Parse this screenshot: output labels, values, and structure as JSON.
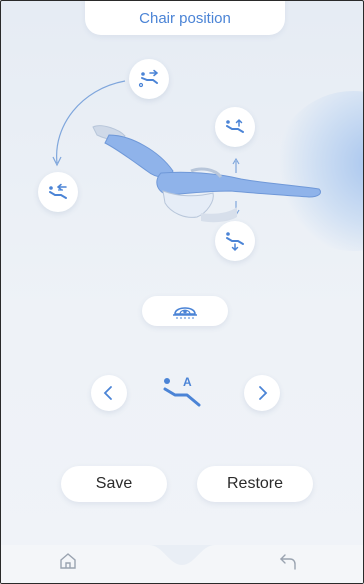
{
  "header": {
    "title": "Chair position"
  },
  "chair_presets": [
    {
      "name": "preset-1-icon"
    },
    {
      "name": "preset-2-icon"
    },
    {
      "name": "up-icon"
    },
    {
      "name": "down-icon"
    }
  ],
  "light": {
    "icon": "dental-light-icon"
  },
  "position_selector": {
    "current": "A"
  },
  "actions": {
    "save_label": "Save",
    "restore_label": "Restore"
  },
  "bottom_nav": {
    "home_icon": "home-icon",
    "back_icon": "back-icon"
  },
  "colors": {
    "accent": "#4b84d6",
    "chair": "#8fb3ea",
    "background": "#e9eef5"
  }
}
